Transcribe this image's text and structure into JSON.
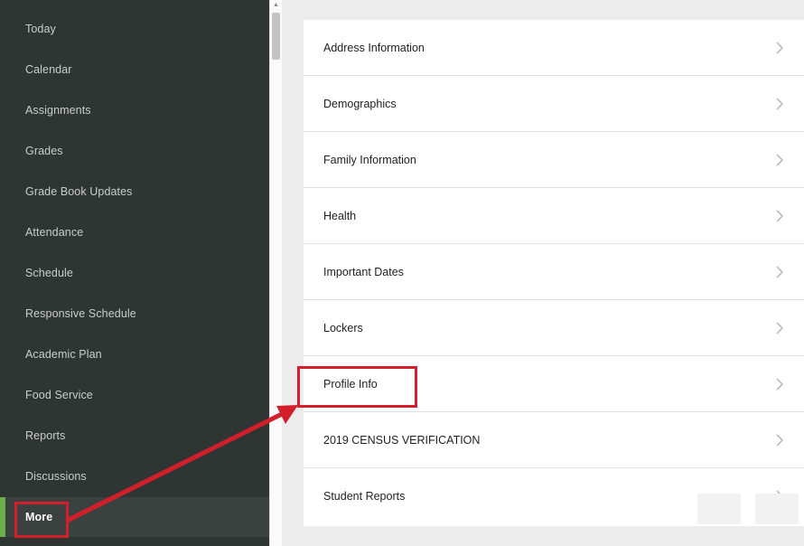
{
  "sidebar": {
    "items": [
      {
        "label": "Today"
      },
      {
        "label": "Calendar"
      },
      {
        "label": "Assignments"
      },
      {
        "label": "Grades"
      },
      {
        "label": "Grade Book Updates"
      },
      {
        "label": "Attendance"
      },
      {
        "label": "Schedule"
      },
      {
        "label": "Responsive Schedule"
      },
      {
        "label": "Academic Plan"
      },
      {
        "label": "Food Service"
      },
      {
        "label": "Reports"
      },
      {
        "label": "Discussions"
      },
      {
        "label": "More",
        "active": true
      }
    ]
  },
  "main": {
    "items": [
      {
        "label": "Address Information"
      },
      {
        "label": "Demographics"
      },
      {
        "label": "Family Information"
      },
      {
        "label": "Health"
      },
      {
        "label": "Important Dates"
      },
      {
        "label": "Lockers"
      },
      {
        "label": "Profile Info",
        "highlighted": true
      },
      {
        "label": "2019 CENSUS VERIFICATION"
      },
      {
        "label": "Student Reports"
      }
    ]
  },
  "colors": {
    "sidebar_bg": "#2f3533",
    "active_accent": "#6db04b",
    "annotation_red": "#d31f2b"
  }
}
